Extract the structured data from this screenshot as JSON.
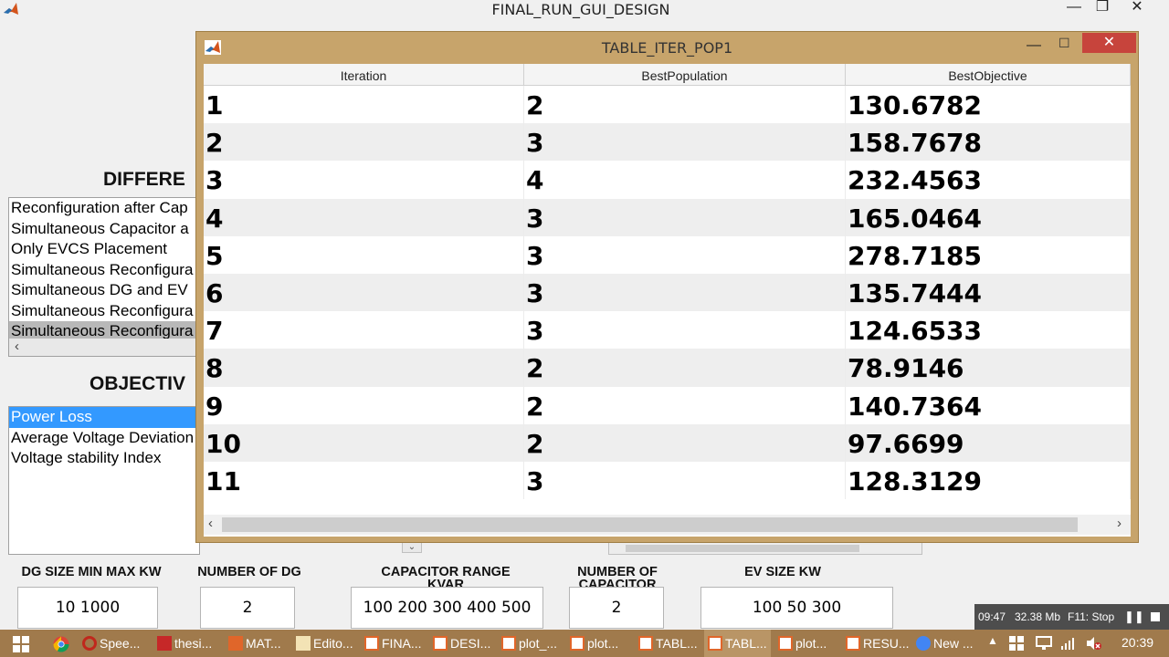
{
  "main_window": {
    "title": "FINAL_RUN_GUI_DESIGN",
    "controls": {
      "minimize": "—",
      "maximize": "❐",
      "close": "✕"
    },
    "section_different": "DIFFERE",
    "different_list": [
      "Reconfiguration after Cap",
      "Simultaneous Capacitor a",
      "Only EVCS Placement",
      "Simultaneous Reconfigura",
      "Simultaneous DG and EV",
      "Simultaneous Reconfigura",
      "Simultaneous Reconfigura"
    ],
    "section_objective": "OBJECTIV",
    "objective_list": [
      "Power Loss",
      "Average Voltage Deviation",
      "Voltage stability Index"
    ],
    "params": [
      {
        "label": "DG SIZE MIN MAX KW",
        "value": "10  1000"
      },
      {
        "label": "NUMBER OF DG",
        "value": "2"
      },
      {
        "label": "CAPACITOR RANGE",
        "label_line2": "KVAR",
        "value": "100  200  300  400  500"
      },
      {
        "label": "NUMBER OF",
        "label_line2": "CAPACITOR",
        "value": "2"
      },
      {
        "label": "EV SIZE KW",
        "value": "100   50  300"
      }
    ]
  },
  "table_window": {
    "title": "TABLE_ITER_POP1",
    "controls": {
      "minimize": "—",
      "maximize": "☐",
      "close": "✕"
    },
    "headers": [
      "Iteration",
      "BestPopulation",
      "BestObjective"
    ],
    "rows": [
      [
        "1",
        "2",
        "130.6782"
      ],
      [
        "2",
        "3",
        "158.7678"
      ],
      [
        "3",
        "4",
        "232.4563"
      ],
      [
        "4",
        "3",
        "165.0464"
      ],
      [
        "5",
        "3",
        "278.7185"
      ],
      [
        "6",
        "3",
        "135.7444"
      ],
      [
        "7",
        "3",
        "124.6533"
      ],
      [
        "8",
        "2",
        "78.9146"
      ],
      [
        "9",
        "2",
        "140.7364"
      ],
      [
        "10",
        "2",
        "97.6699"
      ],
      [
        "11",
        "3",
        "128.3129"
      ]
    ]
  },
  "status_bar": {
    "time": "09:47",
    "memory": "32.38 Mb",
    "hint": "F11: Stop"
  },
  "taskbar": {
    "items": [
      "Spee...",
      "thesi...",
      "MAT...",
      "Edito...",
      "FINA...",
      "DESI...",
      "plot_...",
      "plot...",
      "TABL...",
      "TABL...",
      "plot...",
      "RESU...",
      "New ..."
    ],
    "clock": "20:39"
  },
  "colors": {
    "accent_window": "#c7a46b",
    "close_red": "#c7443c",
    "selection_blue": "#3399ff",
    "taskbar": "#a07a4c"
  }
}
